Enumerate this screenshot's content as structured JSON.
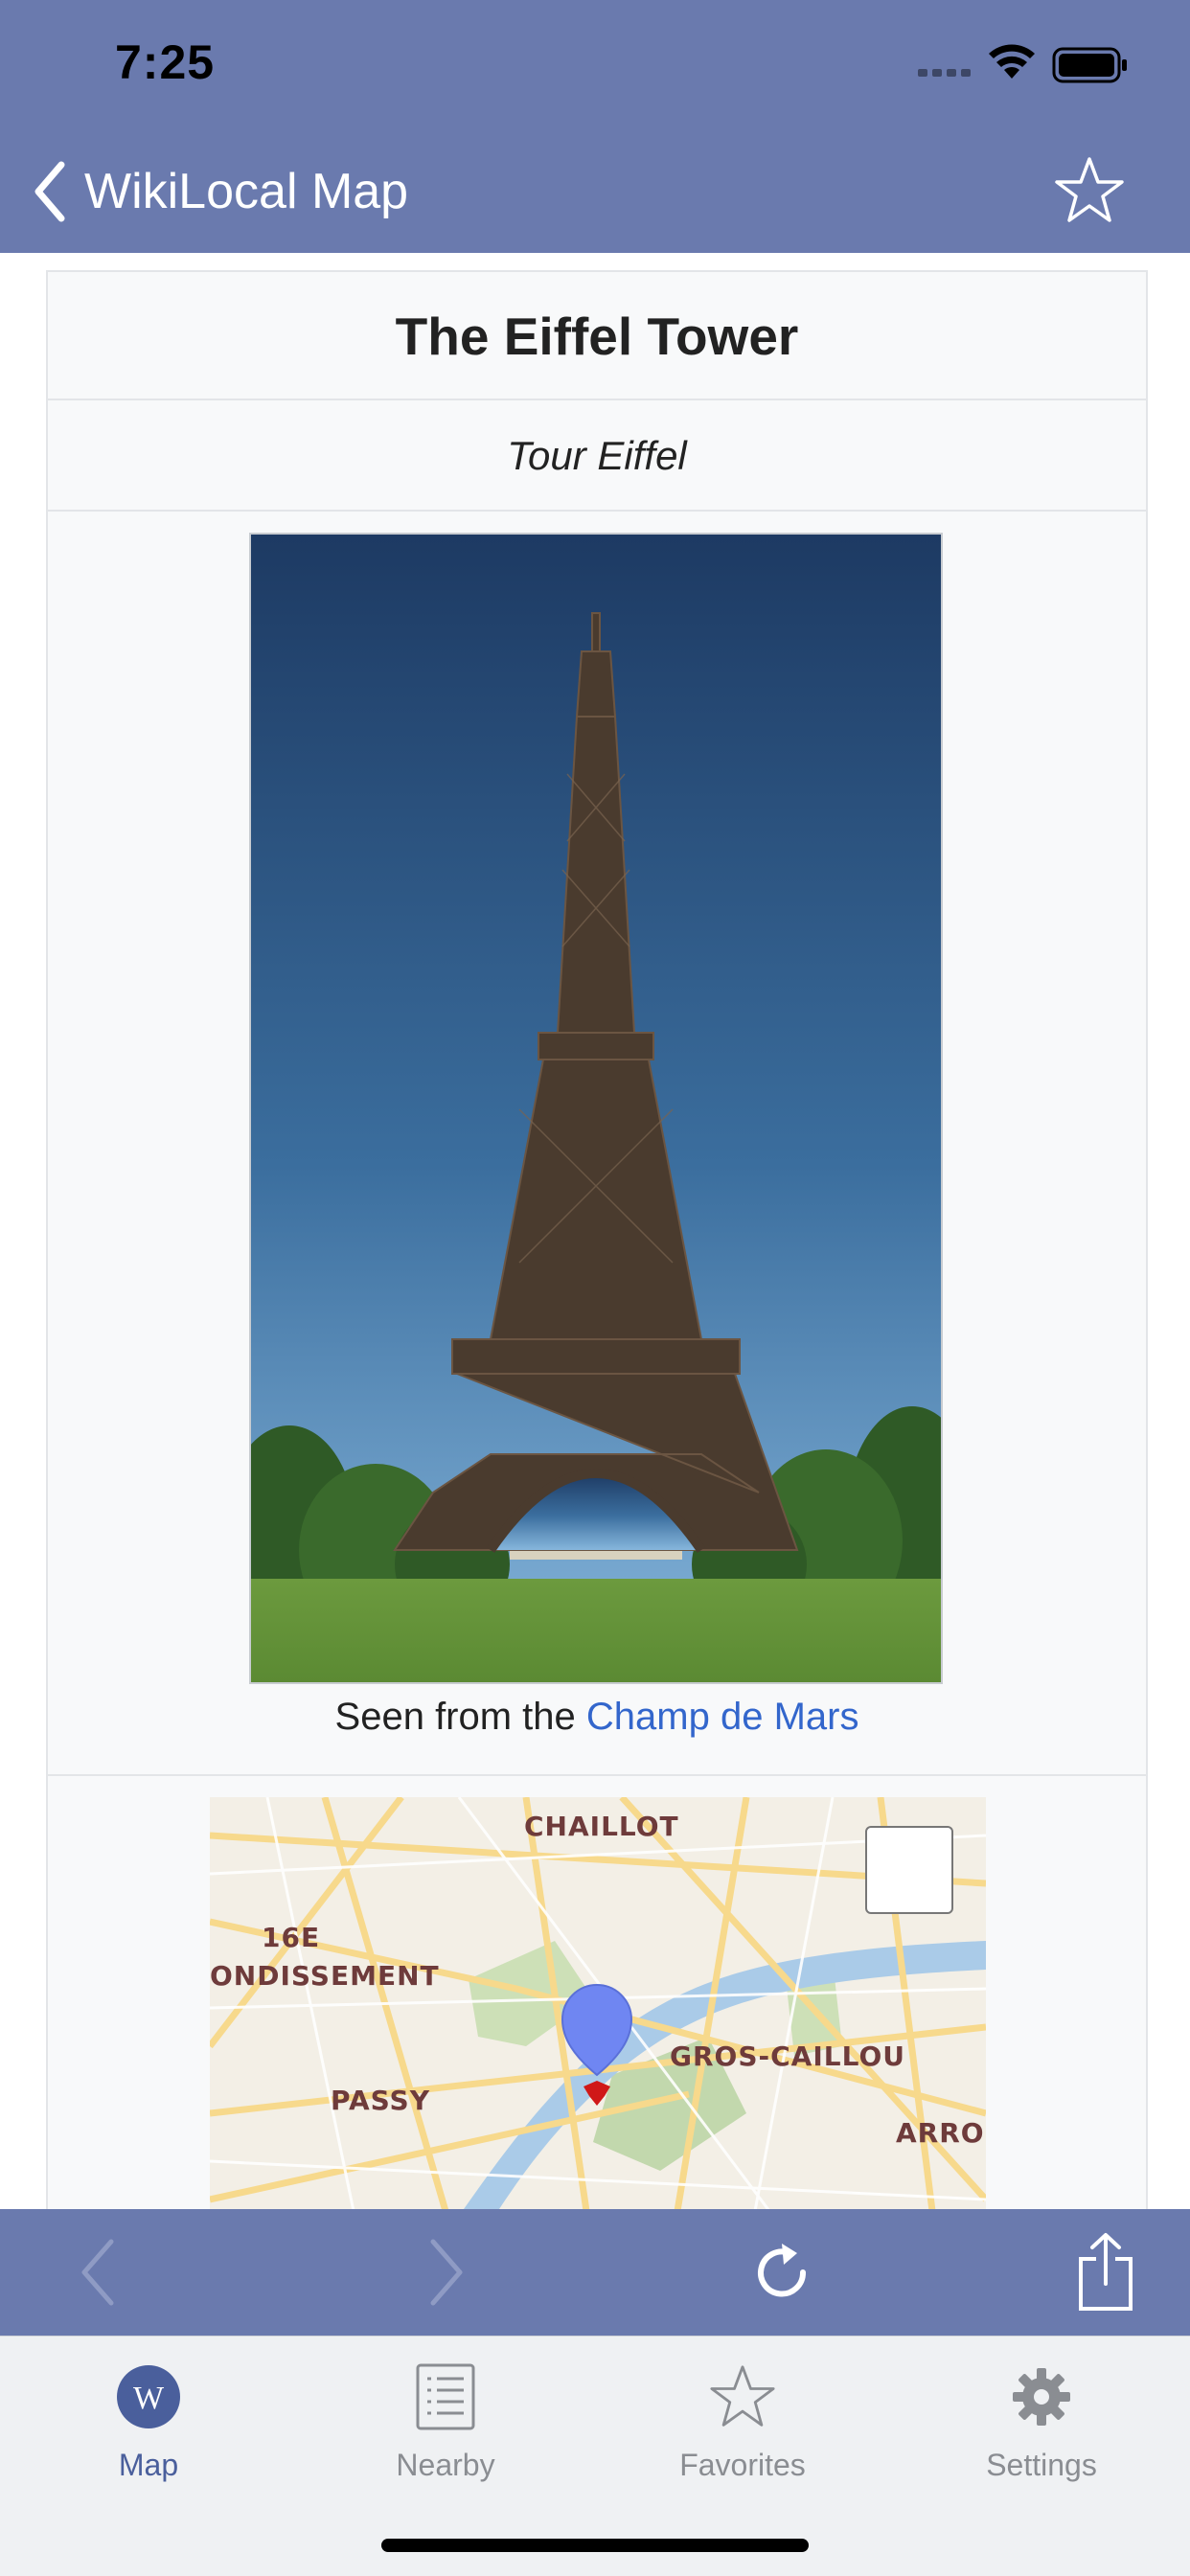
{
  "status_bar": {
    "time": "7:25"
  },
  "nav": {
    "back_label": "WikiLocal Map"
  },
  "article": {
    "title": "The Eiffel Tower",
    "subtitle": "Tour Eiffel",
    "caption_prefix": "Seen from the ",
    "caption_link": "Champ de Mars"
  },
  "map": {
    "labels": [
      "CHAILLOT",
      "16E",
      "ONDISSEMENT",
      "GROS-CAILLOU",
      "PASSY",
      "ARRON"
    ]
  },
  "tabs": [
    {
      "label": "Map",
      "icon": "wikipedia-logo-icon",
      "active": true
    },
    {
      "label": "Nearby",
      "icon": "list-icon",
      "active": false
    },
    {
      "label": "Favorites",
      "icon": "star-icon",
      "active": false
    },
    {
      "label": "Settings",
      "icon": "gear-icon",
      "active": false
    }
  ],
  "colors": {
    "bar": "#6a7aae",
    "link": "#3366cc",
    "active_tab": "#4a5f9c"
  }
}
